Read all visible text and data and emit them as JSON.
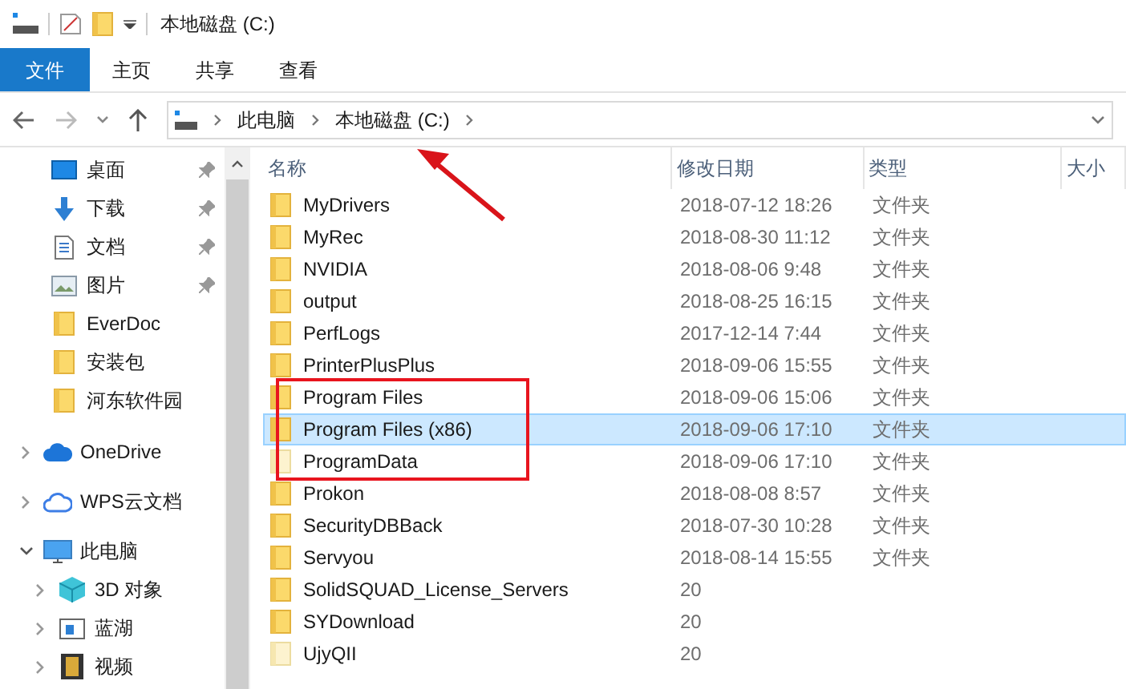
{
  "window": {
    "title": "本地磁盘 (C:)"
  },
  "ribbon_tabs": [
    {
      "label": "文件",
      "kind": "file"
    },
    {
      "label": "主页",
      "kind": "tab"
    },
    {
      "label": "共享",
      "kind": "tab"
    },
    {
      "label": "查看",
      "kind": "tab"
    }
  ],
  "address_bar": {
    "path": [
      "此电脑",
      "本地磁盘 (C:)"
    ]
  },
  "sidebar": {
    "quick_access": [
      {
        "label": "桌面",
        "kind": "desktop",
        "pinned": true
      },
      {
        "label": "下载",
        "kind": "download",
        "pinned": true
      },
      {
        "label": "文档",
        "kind": "document",
        "pinned": true
      },
      {
        "label": "图片",
        "kind": "picture",
        "pinned": true
      },
      {
        "label": "EverDoc",
        "kind": "folder",
        "pinned": false
      },
      {
        "label": "安装包",
        "kind": "folder",
        "pinned": false
      },
      {
        "label": "河东软件园",
        "kind": "folder",
        "pinned": false
      }
    ],
    "tree": [
      {
        "label": "OneDrive",
        "kind": "cloud",
        "expanded": false
      },
      {
        "label": "WPS云文档",
        "kind": "cloudline",
        "expanded": false
      },
      {
        "label": "此电脑",
        "kind": "computer",
        "expanded": true,
        "children": [
          {
            "label": "3D 对象",
            "kind": "cube",
            "expanded": false
          },
          {
            "label": "蓝湖",
            "kind": "window",
            "expanded": false
          },
          {
            "label": "视频",
            "kind": "film",
            "expanded": false
          }
        ]
      }
    ]
  },
  "table": {
    "columns": [
      "名称",
      "修改日期",
      "类型",
      "大小"
    ],
    "rows": [
      {
        "name": "MyDrivers",
        "date": "2018-07-12 18:26",
        "type": "文件夹",
        "selected": false,
        "hidden": false
      },
      {
        "name": "MyRec",
        "date": "2018-08-30 11:12",
        "type": "文件夹",
        "selected": false,
        "hidden": false
      },
      {
        "name": "NVIDIA",
        "date": "2018-08-06 9:48",
        "type": "文件夹",
        "selected": false,
        "hidden": false
      },
      {
        "name": "output",
        "date": "2018-08-25 16:15",
        "type": "文件夹",
        "selected": false,
        "hidden": false
      },
      {
        "name": "PerfLogs",
        "date": "2017-12-14 7:44",
        "type": "文件夹",
        "selected": false,
        "hidden": false
      },
      {
        "name": "PrinterPlusPlus",
        "date": "2018-09-06 15:55",
        "type": "文件夹",
        "selected": false,
        "hidden": false
      },
      {
        "name": "Program Files",
        "date": "2018-09-06 15:06",
        "type": "文件夹",
        "selected": false,
        "hidden": false
      },
      {
        "name": "Program Files (x86)",
        "date": "2018-09-06 17:10",
        "type": "文件夹",
        "selected": true,
        "hidden": false
      },
      {
        "name": "ProgramData",
        "date": "2018-09-06 17:10",
        "type": "文件夹",
        "selected": false,
        "hidden": true
      },
      {
        "name": "Prokon",
        "date": "2018-08-08 8:57",
        "type": "文件夹",
        "selected": false,
        "hidden": false
      },
      {
        "name": "SecurityDBBack",
        "date": "2018-07-30 10:28",
        "type": "文件夹",
        "selected": false,
        "hidden": false
      },
      {
        "name": "Servyou",
        "date": "2018-08-14 15:55",
        "type": "文件夹",
        "selected": false,
        "hidden": false
      },
      {
        "name": "SolidSQUAD_License_Servers",
        "date": "20",
        "selected": false,
        "hidden": false
      },
      {
        "name": "SYDownload",
        "date": "20",
        "selected": false,
        "hidden": false
      },
      {
        "name": "UjyQII",
        "date": "20",
        "selected": false,
        "hidden": true
      }
    ]
  }
}
